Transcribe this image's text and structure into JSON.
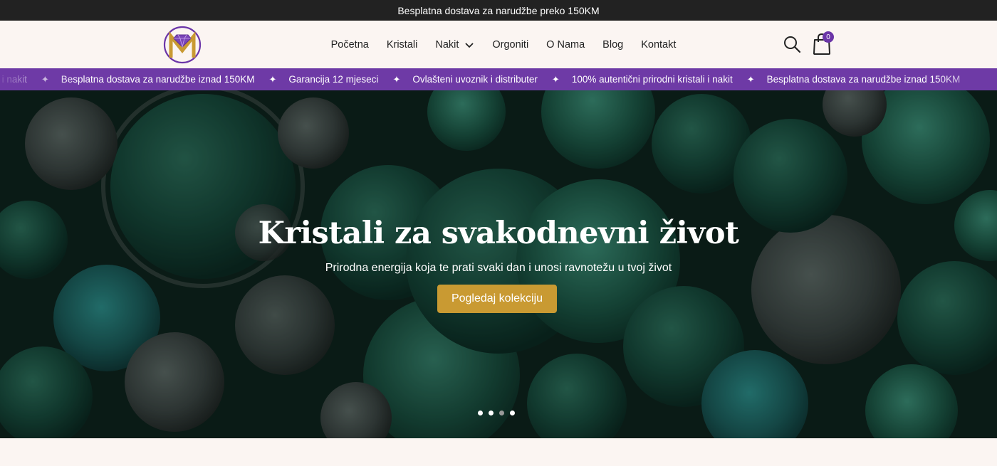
{
  "topbar": {
    "text": "Besplatna dostava za narudžbe preko 150KM"
  },
  "header": {
    "logo_icon": "brand-logo-m-diamond",
    "nav": [
      {
        "label": "Početna"
      },
      {
        "label": "Kristali"
      },
      {
        "label": "Nakit",
        "has_dropdown": true
      },
      {
        "label": "Orgoniti"
      },
      {
        "label": "O Nama"
      },
      {
        "label": "Blog"
      },
      {
        "label": "Kontakt"
      }
    ],
    "search_icon": "search-icon",
    "cart_icon": "shopping-bag-icon",
    "cart_count": "0"
  },
  "ticker": {
    "items": [
      "100% autentični prirodni kristali i nakit",
      "Besplatna dostava za narudžbe iznad 150KM",
      "Garancija 12 mjeseci",
      "Ovlašteni uvoznik i distributer",
      "100% autentični prirodni kristali i nakit",
      "Besplatna dostava za narudžbe iznad 150KM"
    ],
    "separator": "✦"
  },
  "hero": {
    "title": "Kristali za svakodnevni život",
    "subtitle": "Prirodna energija koja te prati svaki dan i unosi ravnotežu u tvoj život",
    "cta": "Pogledaj kolekciju",
    "slides": 4,
    "active_slide": 3
  },
  "colors": {
    "topbar_bg": "#222222",
    "header_bg": "#fbf5f2",
    "ticker_bg": "#6e3aa6",
    "cta_bg": "#c99a32",
    "accent_purple": "#6b35a8",
    "gold": "#c99a32"
  }
}
